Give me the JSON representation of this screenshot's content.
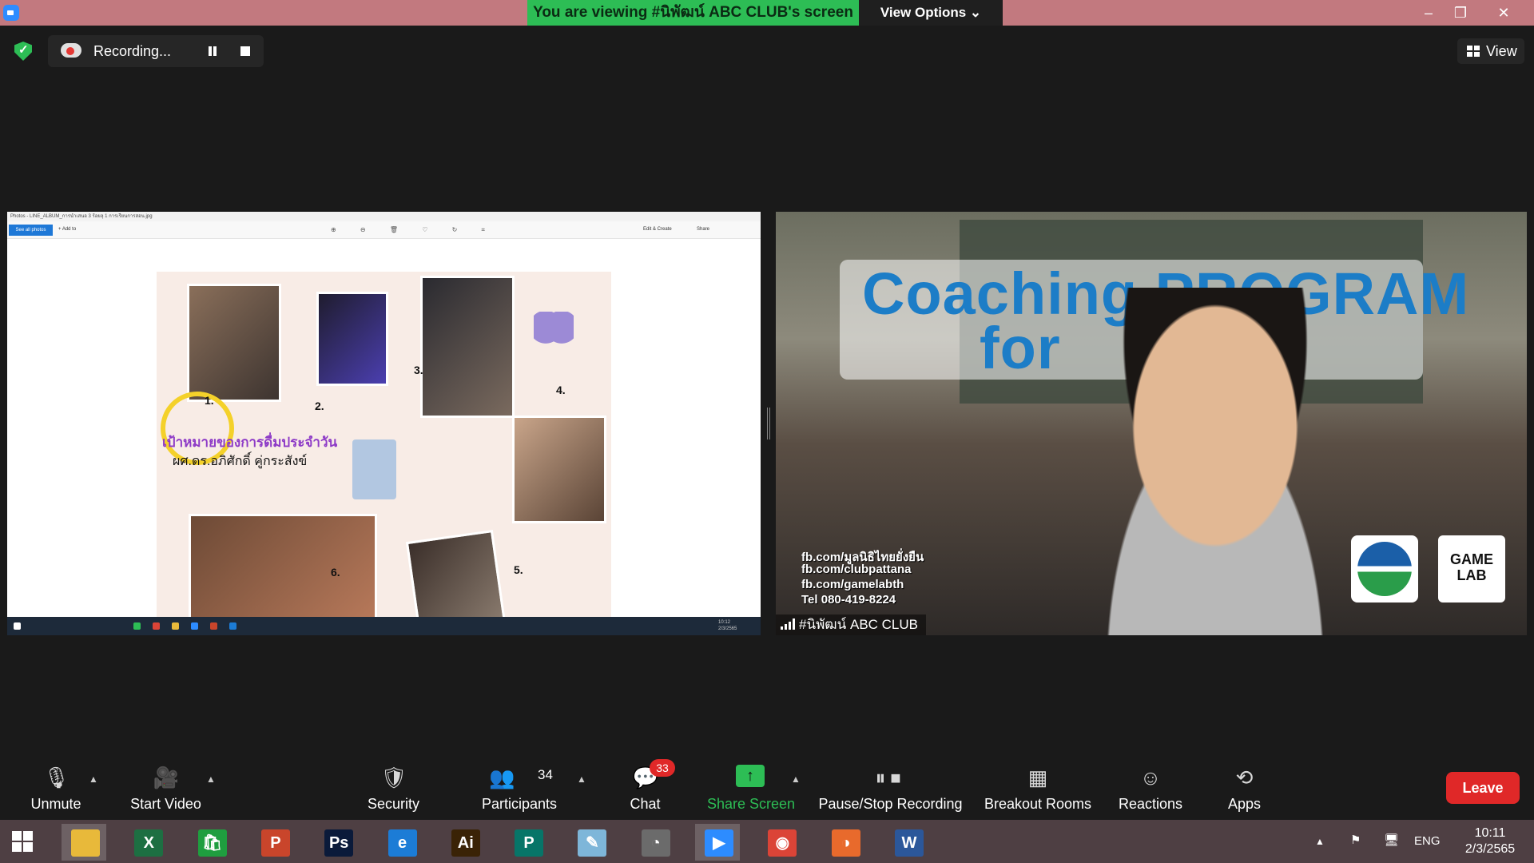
{
  "window": {
    "viewing_banner": "You are viewing #นิพัฒน์ ABC CLUB's screen",
    "view_options_label": "View Options",
    "minimize_glyph": "–",
    "restore_glyph": "❐",
    "close_glyph": "✕"
  },
  "recording": {
    "label": "Recording..."
  },
  "view_button": {
    "label": "View"
  },
  "shared_screen": {
    "titlebar_text": "Photos - LINE_ALBUM_การนำเสนอ 3 ร้อยลุ 1 การเรียนการสอน.jpg",
    "see_all_label": "See all photos",
    "add_to_label": "+ Add to",
    "edit_create_label": "Edit & Create",
    "share_label": "Share",
    "tools_glyphs": "⊕ ⊖ 🗑 ♡ ↻ ⌗",
    "poster_title": "เป้าหมายของการดื่มประจำวัน",
    "poster_author": "ผศ.ดร.อภิศักดิ์ คู่กระสังข์",
    "steps": [
      "1.",
      "2.",
      "3.",
      "4.",
      "5.",
      "6."
    ],
    "mini_clock": "10:12\n2/3/2565"
  },
  "speaker": {
    "name": "#นิพัฒน์ ABC CLUB",
    "banner_line1": "Coaching PROGRAM",
    "banner_line2": "for         er",
    "contacts": [
      "fb.com/มูลนิธิไทยยั่งยืน",
      "fb.com/clubpattana",
      "fb.com/gamelabth",
      "Tel 080-419-8224"
    ],
    "gamelab_logo": "GAME LAB"
  },
  "toolbar": {
    "unmute": "Unmute",
    "start_video": "Start Video",
    "security": "Security",
    "participants": "Participants",
    "participants_count": "34",
    "chat": "Chat",
    "chat_badge": "33",
    "share_screen": "Share Screen",
    "pause_stop_recording": "Pause/Stop Recording",
    "breakout_rooms": "Breakout Rooms",
    "reactions": "Reactions",
    "apps": "Apps",
    "leave": "Leave"
  },
  "taskbar": {
    "apps": [
      {
        "name": "file-explorer",
        "glyph": "",
        "color": "#e8b93a"
      },
      {
        "name": "excel",
        "glyph": "X",
        "color": "#1d6f42"
      },
      {
        "name": "store",
        "glyph": "🛍",
        "color": "#1f9e3f"
      },
      {
        "name": "powerpoint",
        "glyph": "P",
        "color": "#c9452b"
      },
      {
        "name": "photoshop",
        "glyph": "Ps",
        "color": "#0a1a3a"
      },
      {
        "name": "internet-explorer",
        "glyph": "e",
        "color": "#1c7cd6"
      },
      {
        "name": "illustrator",
        "glyph": "Ai",
        "color": "#3a2306"
      },
      {
        "name": "publisher",
        "glyph": "P",
        "color": "#077568"
      },
      {
        "name": "notepad",
        "glyph": "✎",
        "color": "#7eb6d9"
      },
      {
        "name": "photoscape",
        "glyph": "◔",
        "color": "#6b6b6b"
      },
      {
        "name": "zoom",
        "glyph": "▶",
        "color": "#2d8cff"
      },
      {
        "name": "chrome",
        "glyph": "◉",
        "color": "#db4437"
      },
      {
        "name": "photos",
        "glyph": "◑",
        "color": "#e86a2c"
      },
      {
        "name": "word",
        "glyph": "W",
        "color": "#2b579a"
      }
    ],
    "tray_caret": "▲",
    "language": "ENG",
    "time": "10:11",
    "date": "2/3/2565"
  }
}
